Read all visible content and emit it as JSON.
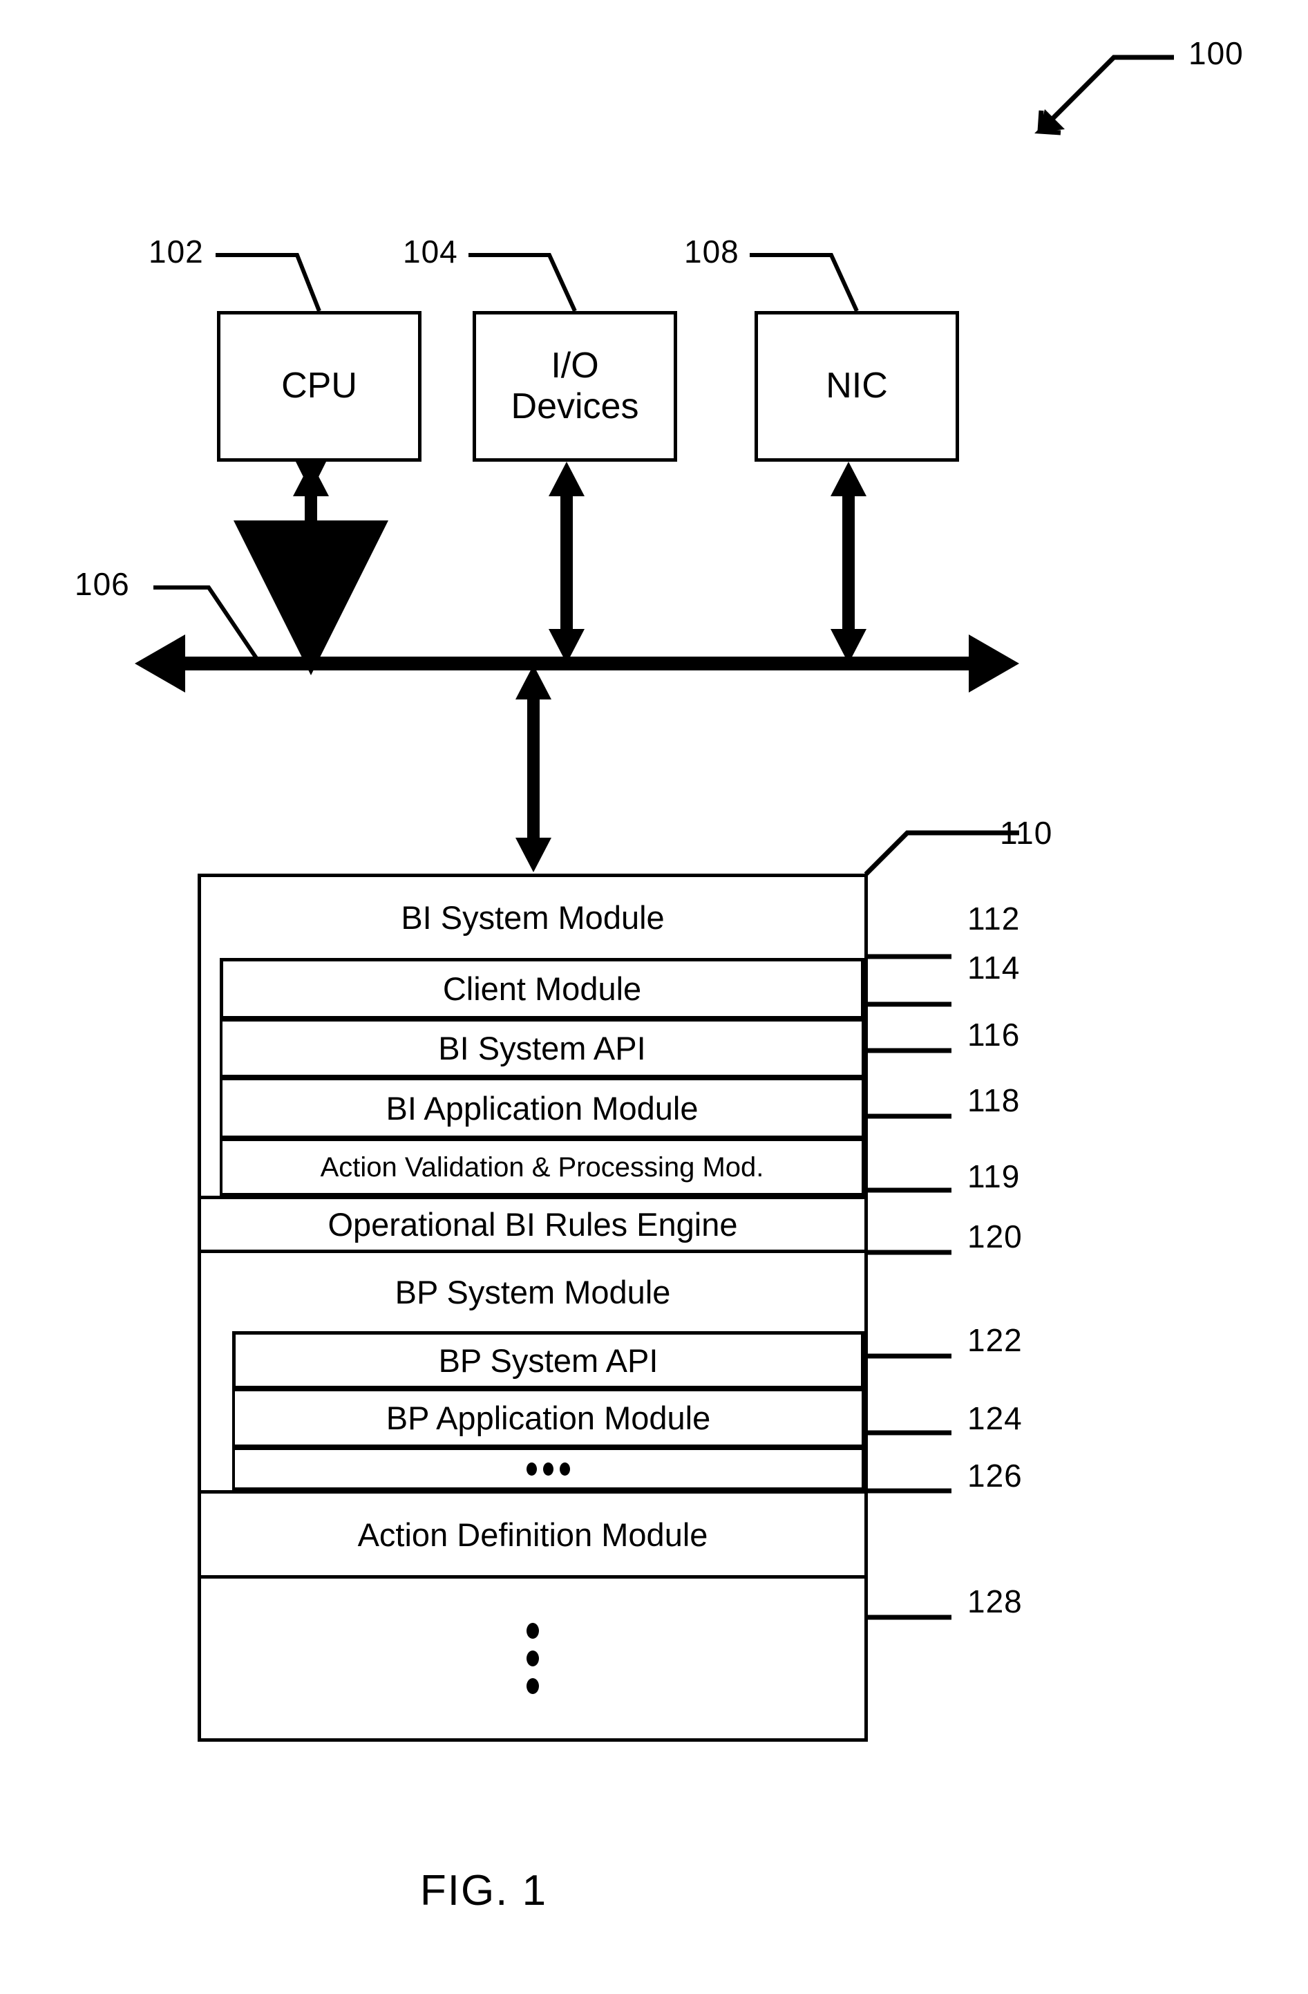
{
  "figure": {
    "caption": "FIG. 1",
    "system_ref": "100"
  },
  "hardware": {
    "cpu": {
      "label": "CPU",
      "ref": "102"
    },
    "io_devices": {
      "label": "I/O\nDevices",
      "label_line1": "I/O",
      "label_line2": "Devices",
      "ref": "104"
    },
    "nic": {
      "label": "NIC",
      "ref": "108"
    },
    "bus": {
      "ref": "106"
    }
  },
  "stack": {
    "ref": "110",
    "rows": [
      {
        "label": "BI System Module",
        "ref": "112",
        "nested": false
      },
      {
        "label": "Client Module",
        "ref": "114",
        "nested": true
      },
      {
        "label": "BI System API",
        "ref": "116",
        "nested": true
      },
      {
        "label": "BI Application Module",
        "ref": "118",
        "nested": true
      },
      {
        "label": "Action Validation & Processing Mod.",
        "ref": "119",
        "nested": true
      },
      {
        "label": "Operational BI Rules Engine",
        "ref": "120",
        "nested": false
      },
      {
        "label": "BP System Module",
        "ref": "122",
        "nested": false
      },
      {
        "label": "BP System API",
        "ref": "124",
        "nested": true
      },
      {
        "label": "BP Application Module",
        "ref": "126",
        "nested": true
      },
      {
        "label": "•••",
        "ref": "",
        "nested": true,
        "is_dots_h": true
      },
      {
        "label": "Action Definition Module",
        "ref": "128",
        "nested": false
      },
      {
        "label": "⋮",
        "ref": "",
        "nested": false,
        "is_dots_v": true
      }
    ]
  },
  "colors": {
    "ink": "#000000",
    "paper": "#ffffff"
  }
}
